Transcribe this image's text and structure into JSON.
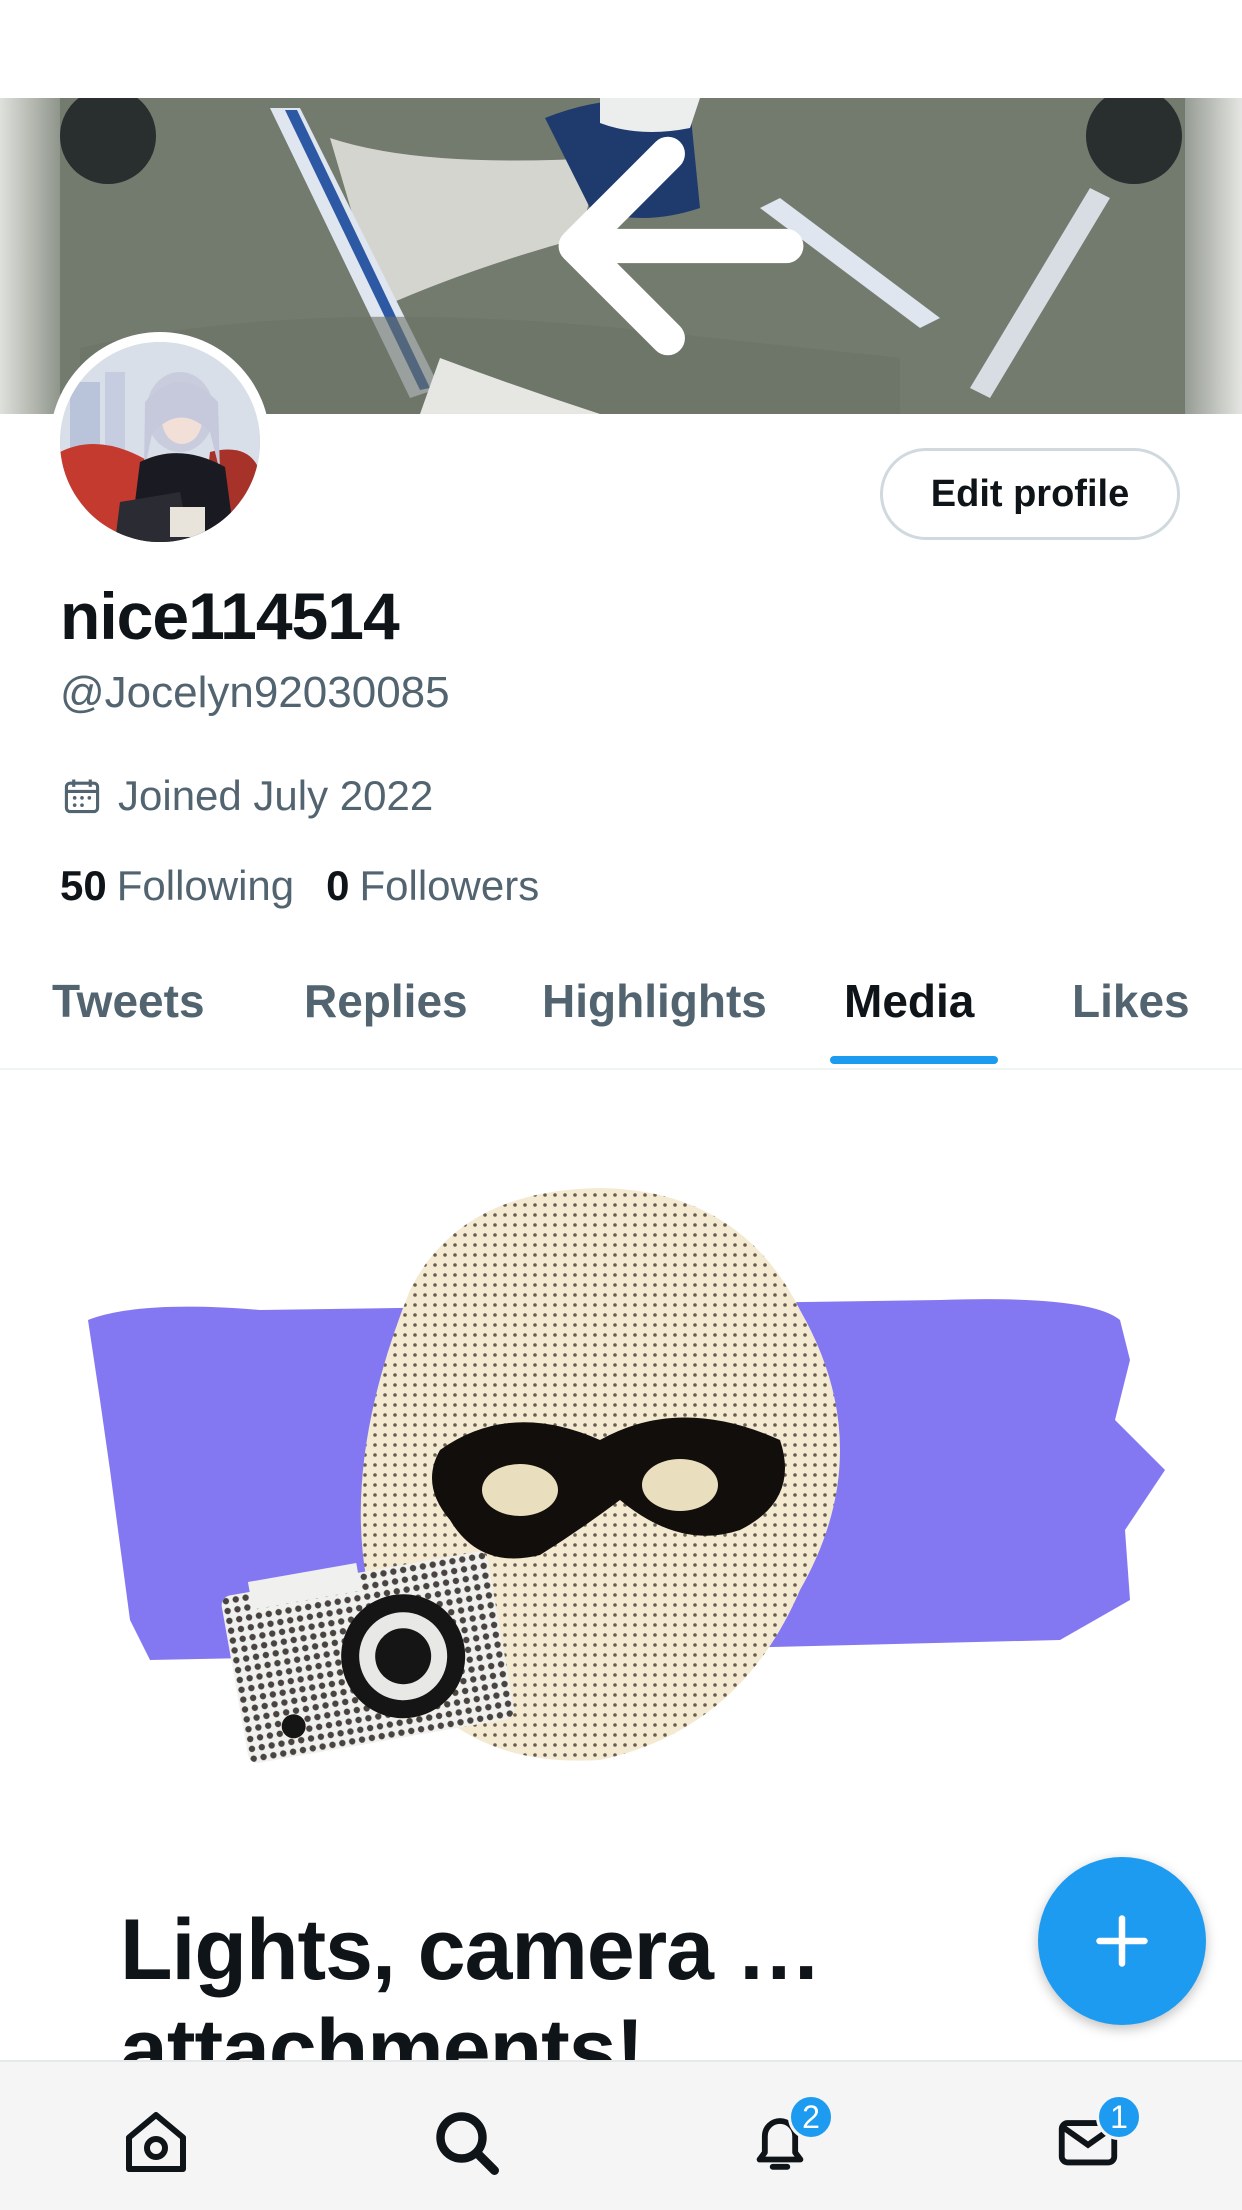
{
  "profile": {
    "edit_label": "Edit profile",
    "display_name": "nice114514",
    "handle": "@Jocelyn92030085",
    "joined": "Joined July 2022",
    "following_count": "50",
    "following_label": "Following",
    "followers_count": "0",
    "followers_label": "Followers"
  },
  "tabs": [
    {
      "label": "Tweets"
    },
    {
      "label": "Replies"
    },
    {
      "label": "Highlights"
    },
    {
      "label": "Media"
    },
    {
      "label": "Likes"
    }
  ],
  "active_tab": "Media",
  "empty_state": {
    "headline": "Lights, camera … attachments!"
  },
  "notifications_badge": "2",
  "messages_badge": "1",
  "colors": {
    "accent": "#1d9bf0",
    "text_primary": "#0f1419",
    "text_secondary": "#536471",
    "illustration_purple": "#8477f2"
  },
  "icons": [
    "back-arrow-icon",
    "search-icon",
    "calendar-icon",
    "plus-icon",
    "home-icon",
    "search-tab-icon",
    "bell-icon",
    "mail-icon"
  ]
}
